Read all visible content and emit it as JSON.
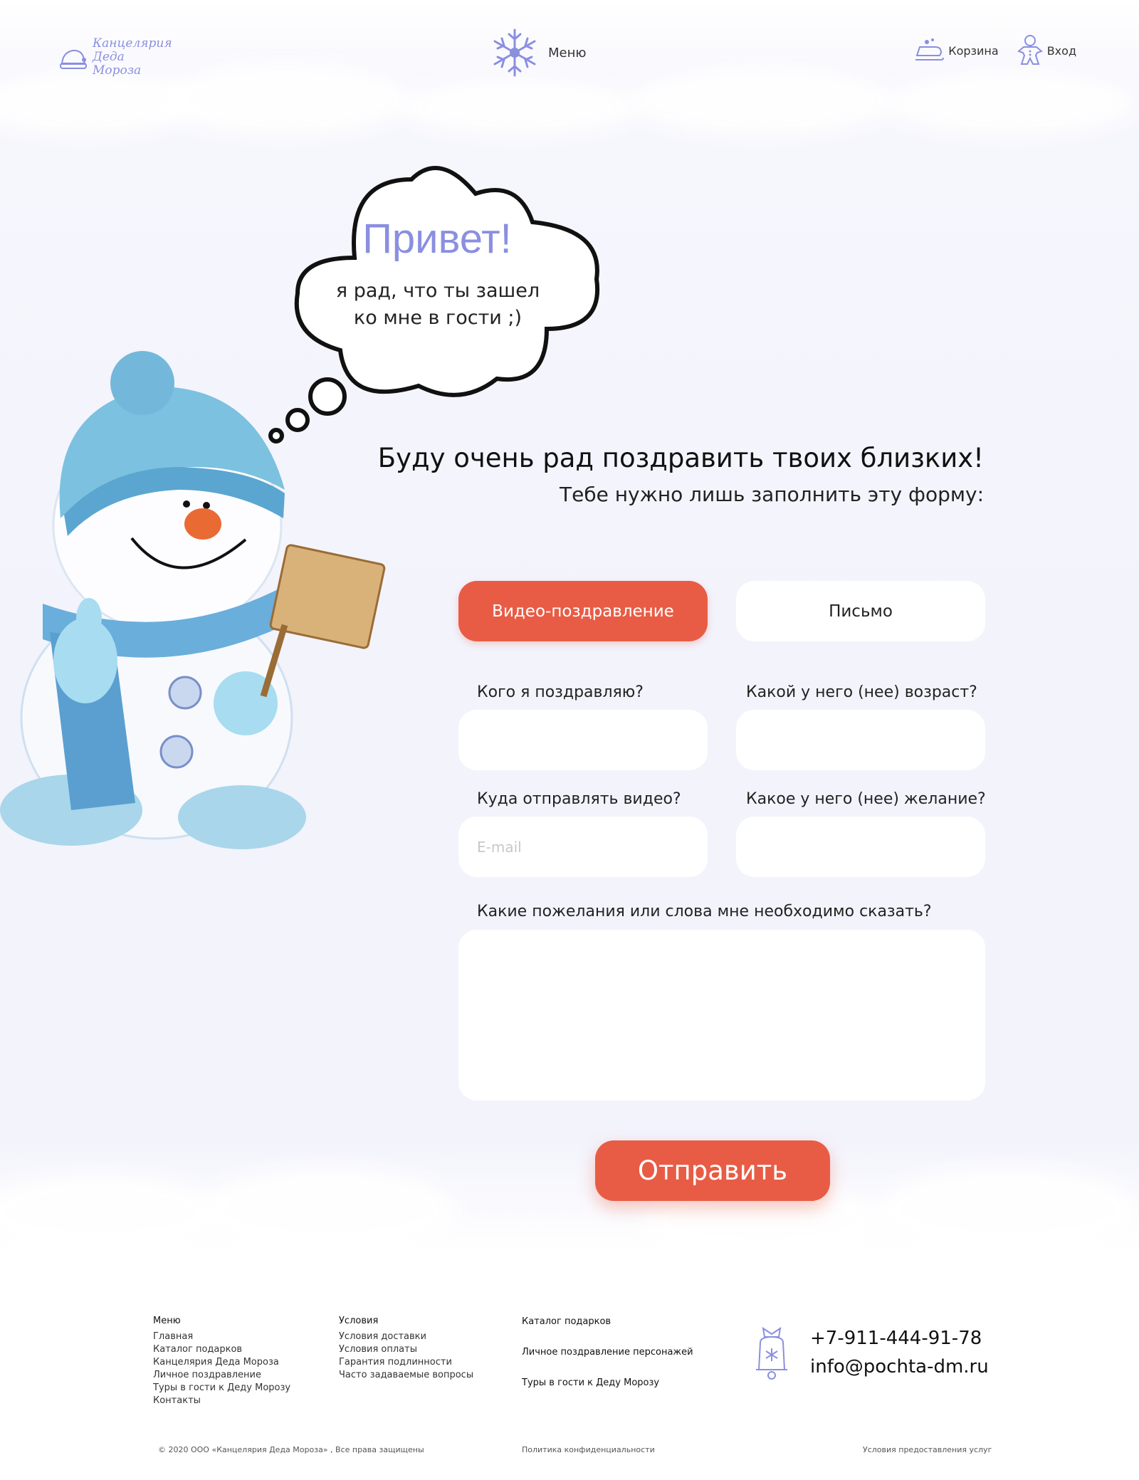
{
  "header": {
    "logo_line1": "Канцелярия",
    "logo_line2": "Деда Мороза",
    "menu_label": "Меню",
    "cart_label": "Корзина",
    "login_label": "Вход"
  },
  "bubble": {
    "title": "Привет!",
    "line1": "я рад, что ты зашел",
    "line2": "ко мне в гости ;)"
  },
  "intro": {
    "heading": "Буду очень рад поздравить твоих близких!",
    "subheading": "Тебе нужно лишь заполнить эту форму:"
  },
  "tabs": [
    {
      "label": "Видео-поздравление",
      "active": true
    },
    {
      "label": "Письмо",
      "active": false
    }
  ],
  "form": {
    "who_label": "Кого я поздравляю?",
    "age_label": "Какой у него (нее) возраст?",
    "where_label": "Куда отправлять видео?",
    "where_placeholder": "E-mail",
    "wish_label": "Какое у него (нее) желание?",
    "words_label": "Какие пожелания или слова мне необходимо сказать?",
    "submit_label": "Отправить"
  },
  "footer": {
    "col1": {
      "title": "Меню",
      "items": [
        "Главная",
        "Каталог подарков",
        "Канцелярия Деда Мороза",
        "Личное поздравление",
        "Туры в гости к Деду Морозу",
        "Контакты"
      ]
    },
    "col2": {
      "title": "Условия",
      "items": [
        "Условия доставки",
        "Условия оплаты",
        "Гарантия подлинности",
        "Часто задаваемые вопросы"
      ]
    },
    "col3": {
      "items": [
        "Каталог подарков",
        "Личное поздравление персонажей",
        "Туры в гости к Деду Морозу"
      ]
    },
    "phone": "+7-911-444-91-78",
    "email": "info@pochta-dm.ru",
    "copyright": "© 2020 ООО «Канцелярия Деда Мороза» , Все права защищены",
    "privacy": "Политика конфиденциальности",
    "terms": "Условия предоставления услуг"
  },
  "colors": {
    "accent": "#e85c45",
    "brand": "#8a8fe0",
    "background": "#f3f3fc"
  },
  "icons": [
    "hat-icon",
    "snowflake-icon",
    "sleigh-icon",
    "gingerbread-icon",
    "bell-icon"
  ]
}
